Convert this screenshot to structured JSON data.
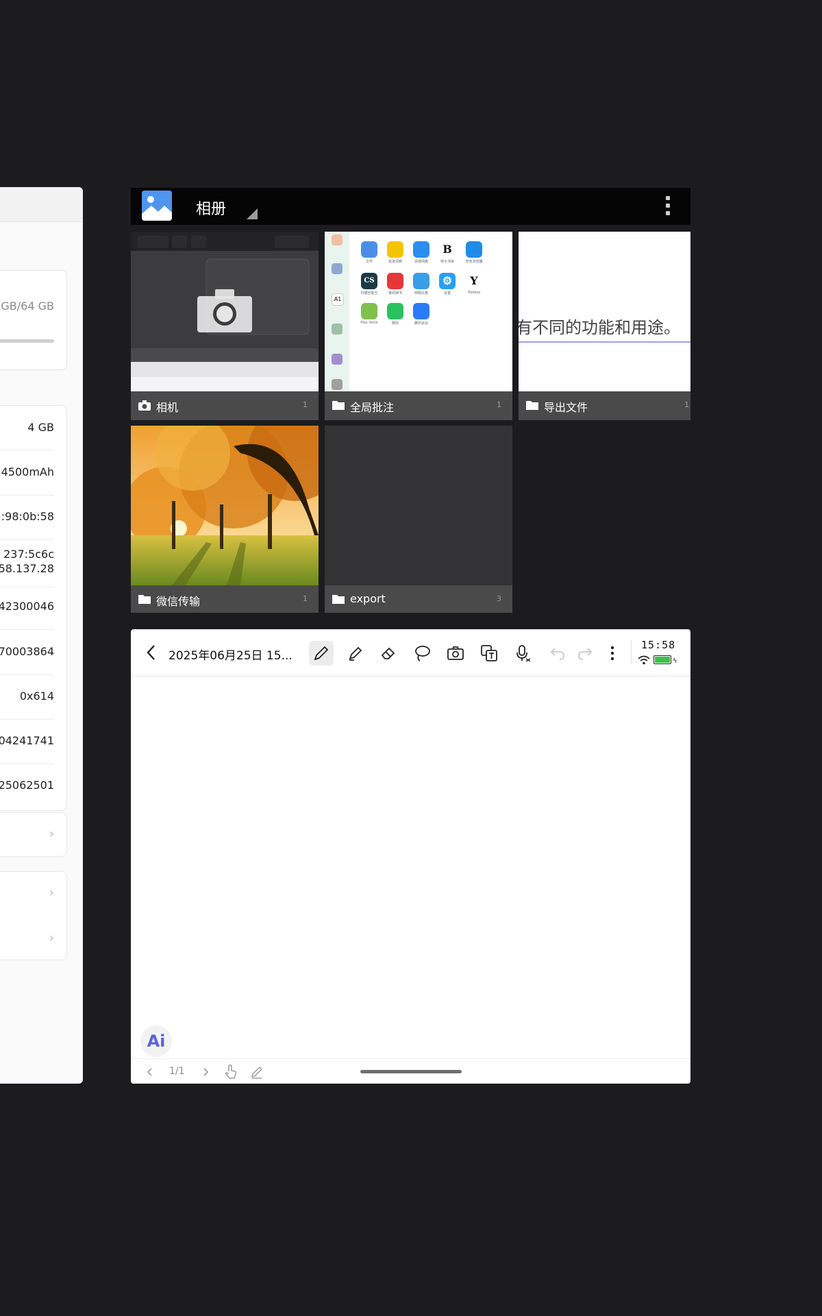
{
  "settings_card": {
    "storage": "GB/64 GB",
    "rows": [
      "4 GB",
      "4500mAh",
      ":98:0b:58",
      "237:5c6c",
      "58.137.28",
      "42300046",
      "70003864",
      "0x614",
      "04241741",
      "25062501"
    ]
  },
  "gallery": {
    "title": "相册",
    "albums": [
      {
        "name": "相机",
        "count": "1",
        "icon": "camera-icon"
      },
      {
        "name": "全局批注",
        "count": "1",
        "icon": "folder-icon"
      },
      {
        "name": "导出文件",
        "count": "1",
        "icon": "folder-icon",
        "preview_text": "有不同的功能和用途。"
      },
      {
        "name": "微信传输",
        "count": "1",
        "icon": "folder-icon"
      },
      {
        "name": "export",
        "count": "3",
        "icon": "folder-icon"
      }
    ],
    "screenshot_apps": [
      {
        "label": "文件",
        "color": "#4a8de8",
        "glyph": ""
      },
      {
        "label": "有道词典",
        "color": "#f5c400",
        "glyph": ""
      },
      {
        "label": "百度网盘",
        "color": "#2b8ef0",
        "glyph": ""
      },
      {
        "label": "电子书库",
        "color": "#ffffff",
        "glyph": "B"
      },
      {
        "label": "夸克浏览器",
        "color": "#1e8ce8",
        "glyph": ""
      },
      {
        "label": "扫描全能王",
        "color": "#1c3a46",
        "glyph": "CS"
      },
      {
        "label": "掌阅读书",
        "color": "#e8353a",
        "glyph": ""
      },
      {
        "label": "网络云盘",
        "color": "#3a9de8",
        "glyph": ""
      },
      {
        "label": "设置",
        "color": "#2a9ff2",
        "glyph": "⚙"
      },
      {
        "label": "Toolbox",
        "color": "#ffffff",
        "glyph": "Y"
      },
      {
        "label": "Play Store",
        "color": "#7fc14d",
        "glyph": ""
      },
      {
        "label": "微信",
        "color": "#2ac15f",
        "glyph": ""
      },
      {
        "label": "腾讯会议",
        "color": "#2a7cf6",
        "glyph": ""
      }
    ]
  },
  "notes": {
    "title": "2025年06月25日 15...",
    "time": "15:58",
    "page": "1/1",
    "ai_label": "Ai",
    "battery_color": "#3fbf4f"
  }
}
